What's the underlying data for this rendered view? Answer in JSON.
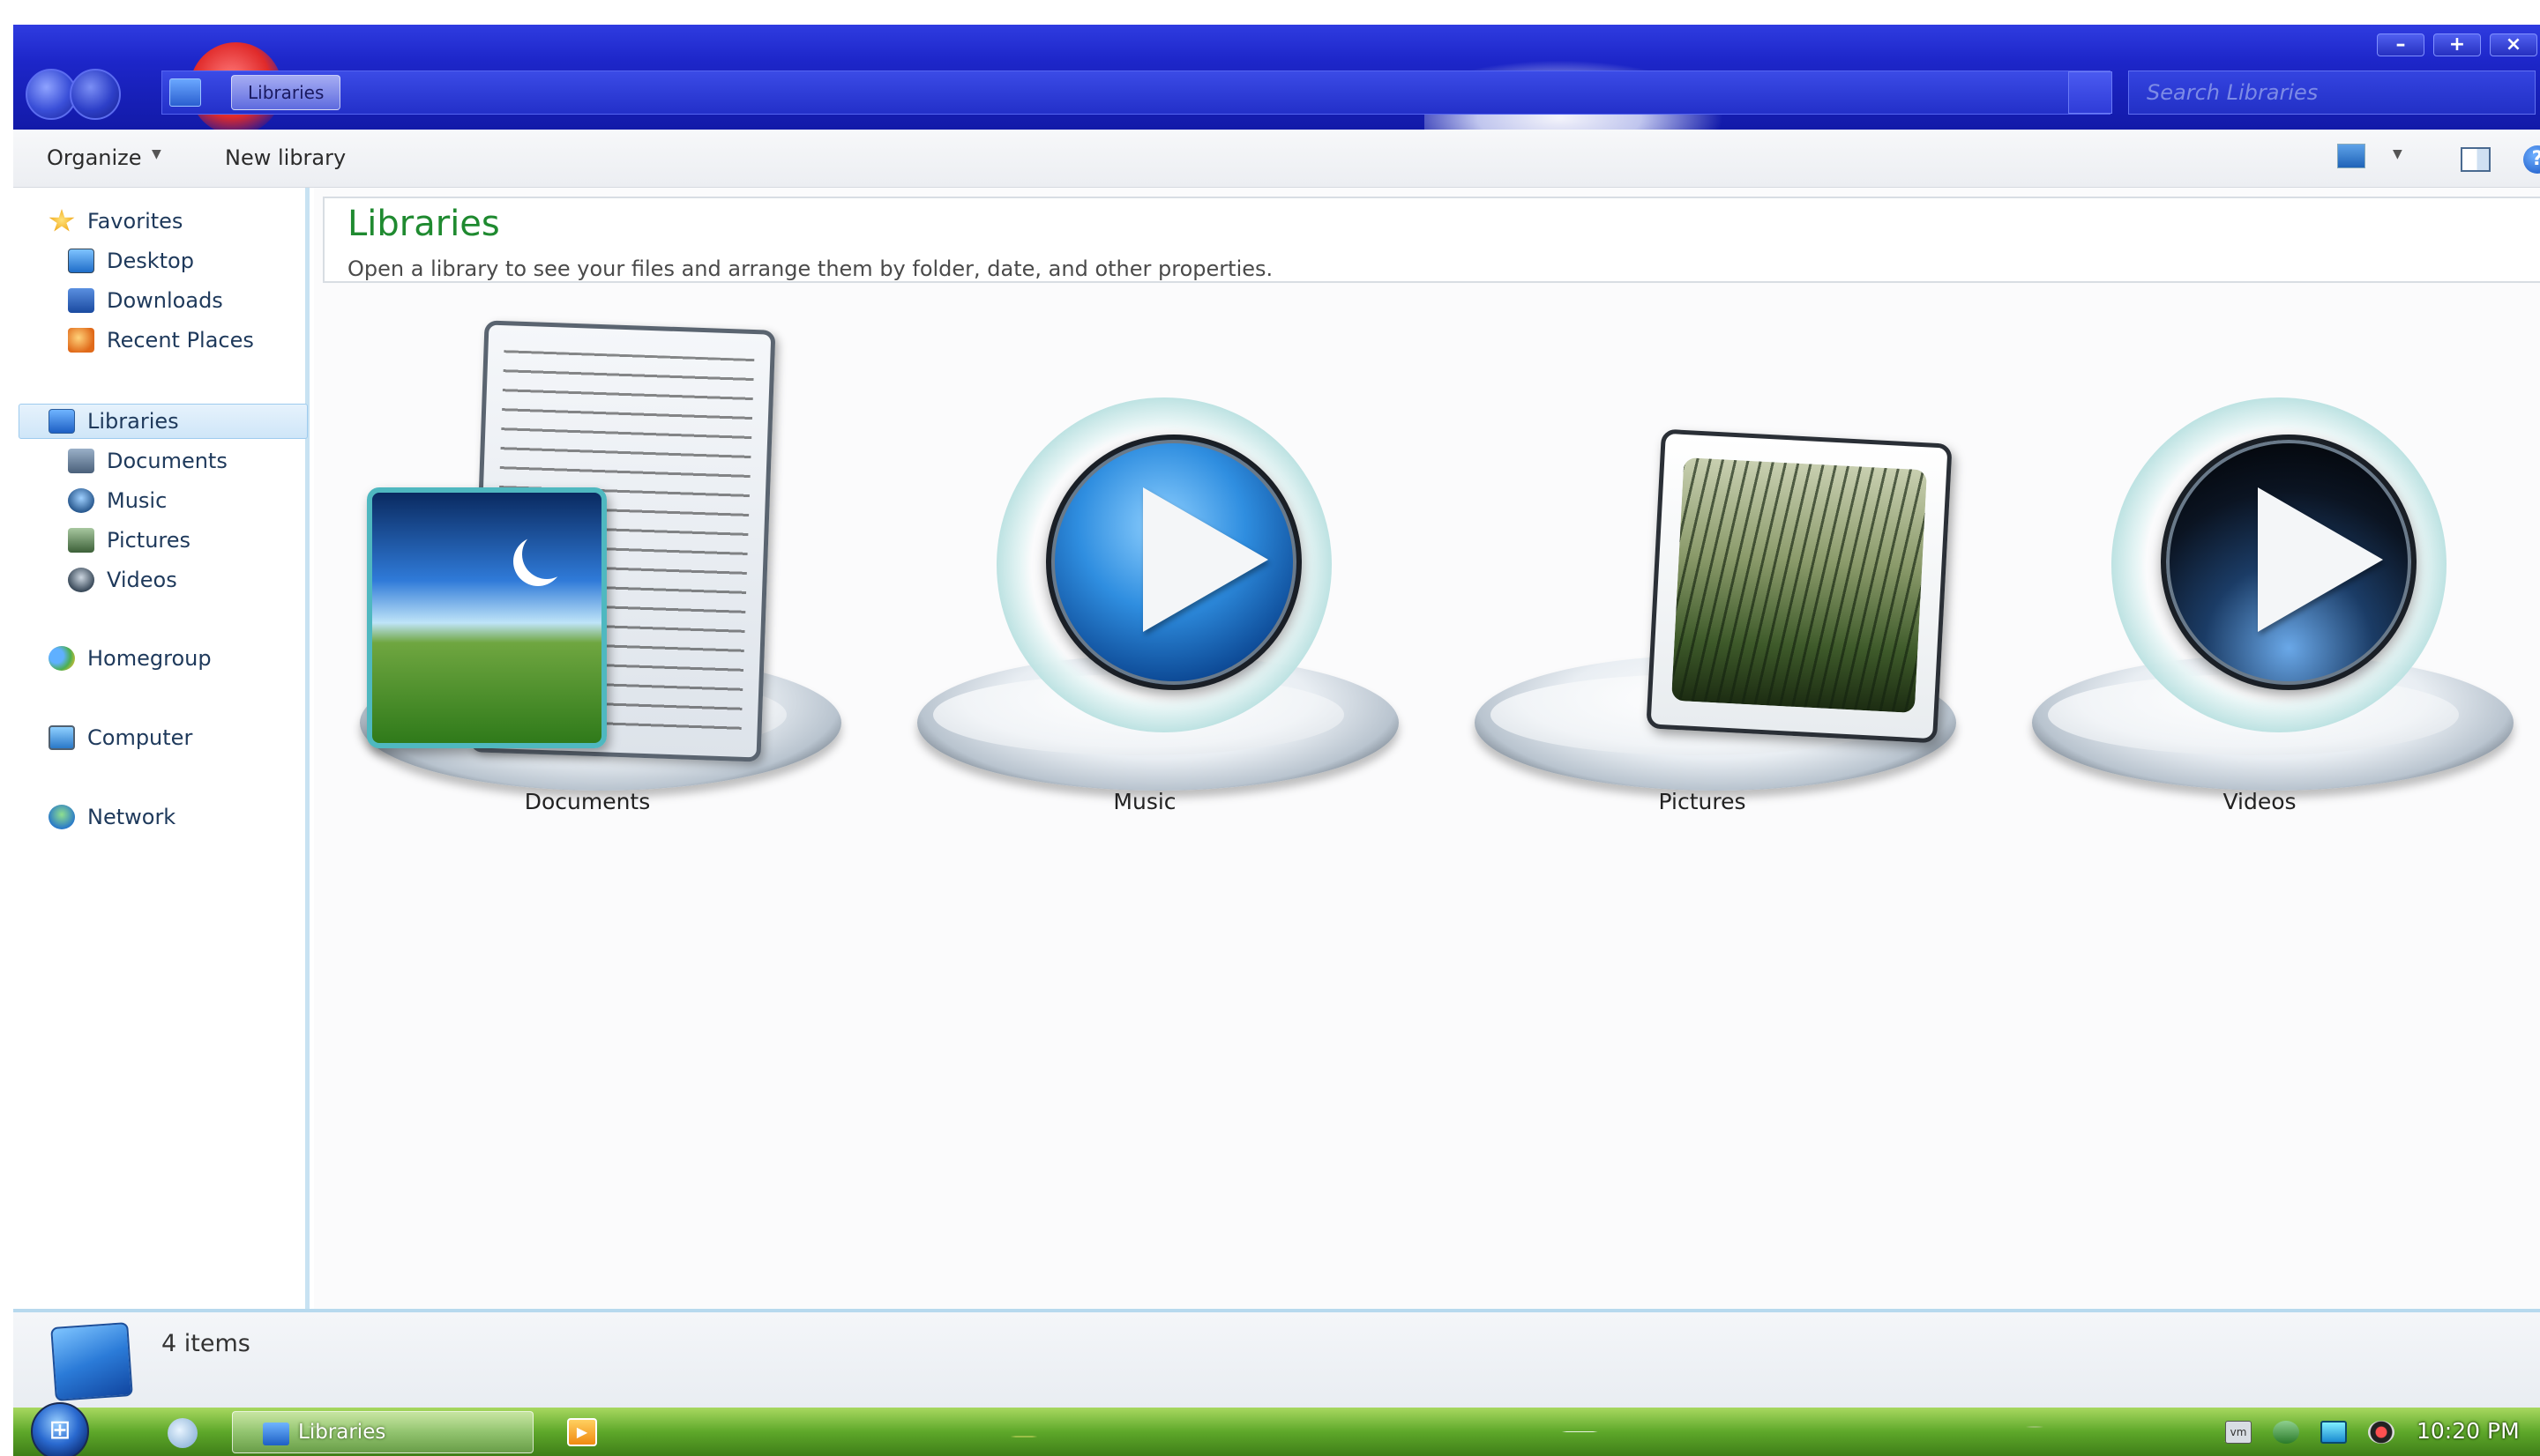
{
  "window": {
    "breadcrumb": "Libraries",
    "search_placeholder": "Search Libraries",
    "controls": {
      "minimize": "–",
      "maximize": "+",
      "close": "×"
    }
  },
  "toolbar": {
    "organize_label": "Organize",
    "new_library_label": "New library",
    "help_label": "?"
  },
  "sidebar": {
    "favorites": "Favorites",
    "favorites_items": [
      "Desktop",
      "Downloads",
      "Recent Places"
    ],
    "libraries": "Libraries",
    "libraries_items": [
      "Documents",
      "Music",
      "Pictures",
      "Videos"
    ],
    "homegroup": "Homegroup",
    "computer": "Computer",
    "network": "Network"
  },
  "main": {
    "title": "Libraries",
    "subtitle": "Open a library to see your files and arrange them by folder, date, and other properties.",
    "libraries": [
      {
        "label": "Documents",
        "icon": "documents-library-icon"
      },
      {
        "label": "Music",
        "icon": "music-library-icon"
      },
      {
        "label": "Pictures",
        "icon": "pictures-library-icon"
      },
      {
        "label": "Videos",
        "icon": "videos-library-icon"
      }
    ]
  },
  "details": {
    "items_count": "4 items"
  },
  "taskbar": {
    "active_window": "Libraries",
    "tray_vm_label": "vm",
    "clock": "10:20 PM"
  },
  "colors": {
    "titlebar": "#1d26c9",
    "title_text": "#1f8a30",
    "nav_selected": "#cfe6f8",
    "taskbar": "#5ea82a"
  }
}
